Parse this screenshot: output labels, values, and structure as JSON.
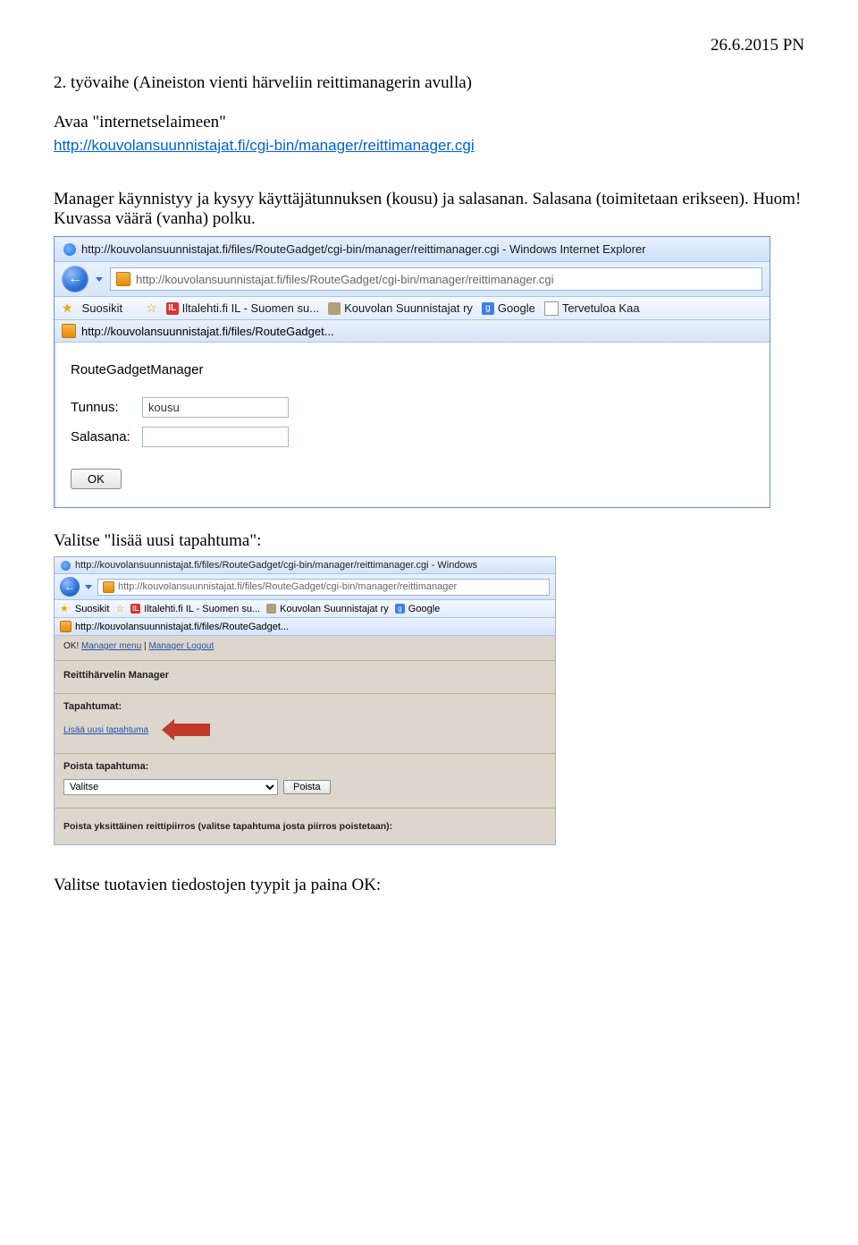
{
  "header": {
    "date": "26.6.2015 PN"
  },
  "title": "2. työvaihe (Aineiston vienti härveliin reittimanagerin avulla)",
  "para1_a": "Avaa \"internetselaimeen\"",
  "link1": "http://kouvolansuunnistajat.fi/cgi-bin/manager/reittimanager.cgi",
  "para2": "Manager käynnistyy ja kysyy käyttäjätunnuksen (kousu) ja salasanan. Salasana (toimitetaan erikseen). Huom! Kuvassa väärä (vanha) polku.",
  "shot1": {
    "titlebar": "http://kouvolansuunnistajat.fi/files/RouteGadget/cgi-bin/manager/reittimanager.cgi - Windows Internet Explorer",
    "url": "http://kouvolansuunnistajat.fi/files/RouteGadget/cgi-bin/manager/reittimanager.cgi",
    "fav_label": "Suosikit",
    "fav_items": [
      "Iltalehti.fi IL - Suomen su...",
      "Kouvolan Suunnistajat ry",
      "Google",
      "Tervetuloa Kaa"
    ],
    "tab": "http://kouvolansuunnistajat.fi/files/RouteGadget...",
    "app_title": "RouteGadgetManager",
    "user_label": "Tunnus:",
    "user_value": "kousu",
    "pass_label": "Salasana:",
    "ok": "OK"
  },
  "para3": "Valitse \"lisää uusi tapahtuma\":",
  "shot2": {
    "titlebar": "http://kouvolansuunnistajat.fi/files/RouteGadget/cgi-bin/manager/reittimanager.cgi - Windows",
    "url": "http://kouvolansuunnistajat.fi/files/RouteGadget/cgi-bin/manager/reittimanager",
    "fav_label": "Suosikit",
    "fav_items": [
      "Iltalehti.fi IL - Suomen su...",
      "Kouvolan Suunnistajat ry",
      "Google"
    ],
    "tab": "http://kouvolansuunnistajat.fi/files/RouteGadget...",
    "status_ok": "OK!",
    "menu_link": "Manager menu",
    "logout_link": "Manager Logout",
    "heading": "Reittihärvelin Manager",
    "events_label": "Tapahtumat:",
    "add_link": "Lisää uusi tapahtuma",
    "delete_label": "Poista tapahtuma:",
    "select_value": "Valitse",
    "delete_btn": "Poista",
    "note": "Poista yksittäinen reittipiirros (valitse tapahtuma josta piirros poistetaan):"
  },
  "para4": "Valitse tuotavien tiedostojen tyypit ja paina OK:"
}
